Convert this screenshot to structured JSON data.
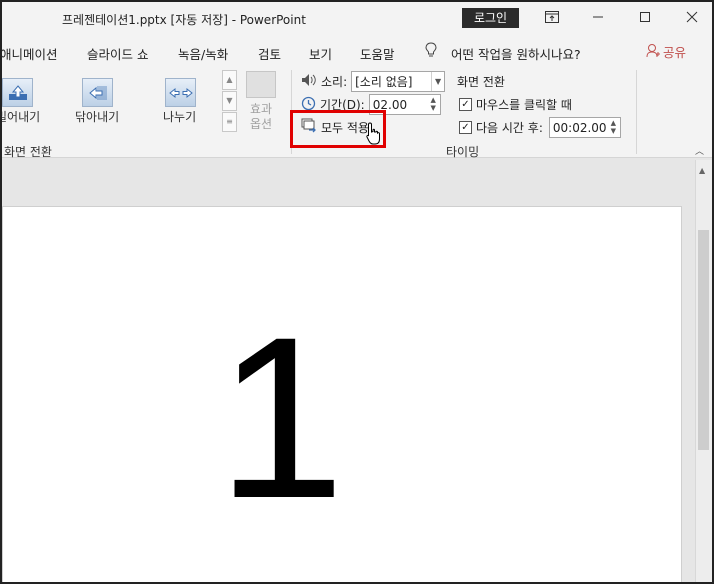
{
  "titlebar": {
    "document_title": "프레젠테이션1.pptx [자동 저장]  -  PowerPoint",
    "login_label": "로그인",
    "icons": [
      "ribbon-display-icon",
      "minimize-icon",
      "maximize-icon",
      "close-icon"
    ]
  },
  "tabs": [
    {
      "label": "애니메이션"
    },
    {
      "label": "슬라이드 쇼"
    },
    {
      "label": "녹음/녹화"
    },
    {
      "label": "검토"
    },
    {
      "label": "보기"
    },
    {
      "label": "도움말"
    }
  ],
  "tell_me": "어떤 작업을 원하시나요?",
  "share_label": "공유",
  "transitions_gallery": {
    "items": [
      {
        "label": "밀어내기",
        "icon": "push-up-arrow-icon"
      },
      {
        "label": "닦아내기",
        "icon": "wipe-left-arrow-icon"
      },
      {
        "label": "나누기",
        "icon": "split-arrows-icon"
      }
    ],
    "effect_options_label": "효과\n옵션",
    "group_label": "화면 전환"
  },
  "timing": {
    "sound_label": "소리:",
    "sound_value": "[소리 없음]",
    "duration_label": "기간(D):",
    "duration_value": "02.00",
    "apply_all_label": "모두 적용",
    "advance_title": "화면 전환",
    "on_click_label": "마우스를 클릭할 때",
    "on_click_checked": true,
    "after_label": "다음 시간 후:",
    "after_checked": true,
    "after_value": "00:02.00",
    "group_label": "타이밍"
  },
  "slide": {
    "content": "1"
  },
  "colors": {
    "highlight": "#e00000",
    "share": "#c0504d",
    "ribbon_bg": "#f3f3f3"
  }
}
